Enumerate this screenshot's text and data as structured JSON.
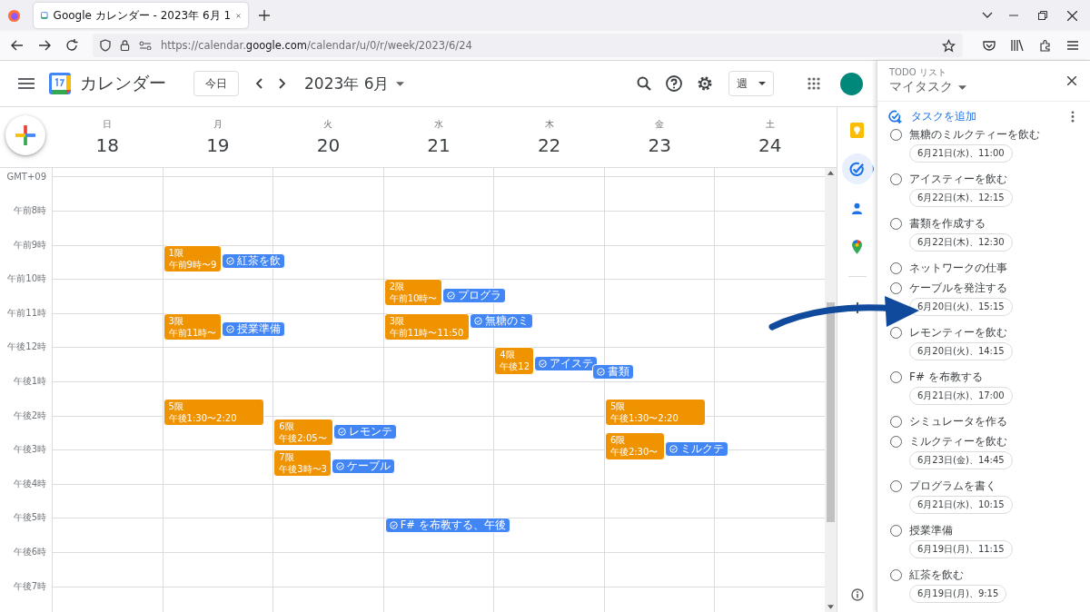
{
  "browser": {
    "tab_title": "Google カレンダー - 2023年 6月 1",
    "url_prefix": "https://calendar.",
    "url_domain": "google.com",
    "url_path": "/calendar/u/0/r/week/2023/6/24"
  },
  "app": {
    "name": "カレンダー",
    "today_button": "今日",
    "period": "2023年 6月",
    "view_button": "週"
  },
  "days": [
    {
      "weekday": "日",
      "date": "18"
    },
    {
      "weekday": "月",
      "date": "19",
      "events": [
        {
          "title": "1限",
          "time": "午前9時〜9"
        },
        {
          "title": "3限",
          "time": "午前11時〜"
        },
        {
          "title": "5限",
          "time": "午後1:30〜2:20"
        }
      ],
      "task_chips": [
        "紅茶を飲",
        "授業準備"
      ]
    },
    {
      "weekday": "火",
      "date": "20",
      "events": [
        {
          "title": "6限",
          "time": "午後2:05〜"
        },
        {
          "title": "7限",
          "time": "午後3時〜3"
        }
      ],
      "task_chips": [
        "レモンテ",
        "ケーブル"
      ]
    },
    {
      "weekday": "水",
      "date": "21",
      "events": [
        {
          "title": "2限",
          "time": "午前10時〜"
        },
        {
          "title": "3限",
          "time": "午前11時〜11:50"
        }
      ],
      "task_chips": [
        "プログラ",
        "無糖のミ",
        "F# を布教する、午後"
      ]
    },
    {
      "weekday": "木",
      "date": "22",
      "events": [
        {
          "title": "4限",
          "time": "午後12"
        }
      ],
      "task_chips": [
        "アイステ",
        "書類"
      ]
    },
    {
      "weekday": "金",
      "date": "23",
      "events": [
        {
          "title": "5限",
          "time": "午後1:30〜2:20"
        },
        {
          "title": "6限",
          "time": "午後2:30〜"
        }
      ],
      "task_chips": [
        "ミルクテ"
      ]
    },
    {
      "weekday": "土",
      "date": "24"
    }
  ],
  "time_labels": [
    "GMT+09",
    "午前8時",
    "午前9時",
    "午前10時",
    "午前11時",
    "午後12時",
    "午後1時",
    "午後2時",
    "午後3時",
    "午後4時",
    "午後5時",
    "午後6時",
    "午後7時"
  ],
  "side_apps": [
    {
      "kind": "keep",
      "selected": false
    },
    {
      "kind": "tasks",
      "selected": true
    },
    {
      "kind": "contacts",
      "selected": false
    },
    {
      "kind": "maps",
      "selected": false
    }
  ],
  "tasks_panel": {
    "heading": "TODO リスト",
    "list_name": "マイタスク",
    "add_label": "タスクを追加",
    "tasks": [
      {
        "title": "無糖のミルクティーを飲む",
        "due": "6月21日(水)、11:00",
        "done": false
      },
      {
        "title": "アイスティーを飲む",
        "due": "6月22日(木)、12:15",
        "done": false
      },
      {
        "title": "書類を作成する",
        "due": "6月22日(木)、12:30",
        "done": false
      },
      {
        "title": "ネットワークの仕事",
        "done": false
      },
      {
        "title": "ケーブルを発注する",
        "due": "6月20日(火)、15:15",
        "done": false
      },
      {
        "title": "レモンティーを飲む",
        "due": "6月20日(火)、14:15",
        "done": false
      },
      {
        "title": "F# を布教する",
        "due": "6月21日(水)、17:00",
        "done": false
      },
      {
        "title": "シミュレータを作る",
        "done": false
      },
      {
        "title": "ミルクティーを飲む",
        "due": "6月23日(金)、14:45",
        "done": false
      },
      {
        "title": "プログラムを書く",
        "due": "6月21日(水)、10:15",
        "done": false
      },
      {
        "title": "授業準備",
        "due": "6月19日(月)、11:15",
        "done": false
      },
      {
        "title": "紅茶を飲む",
        "due": "6月19日(月)、9:15",
        "done": false
      }
    ]
  }
}
